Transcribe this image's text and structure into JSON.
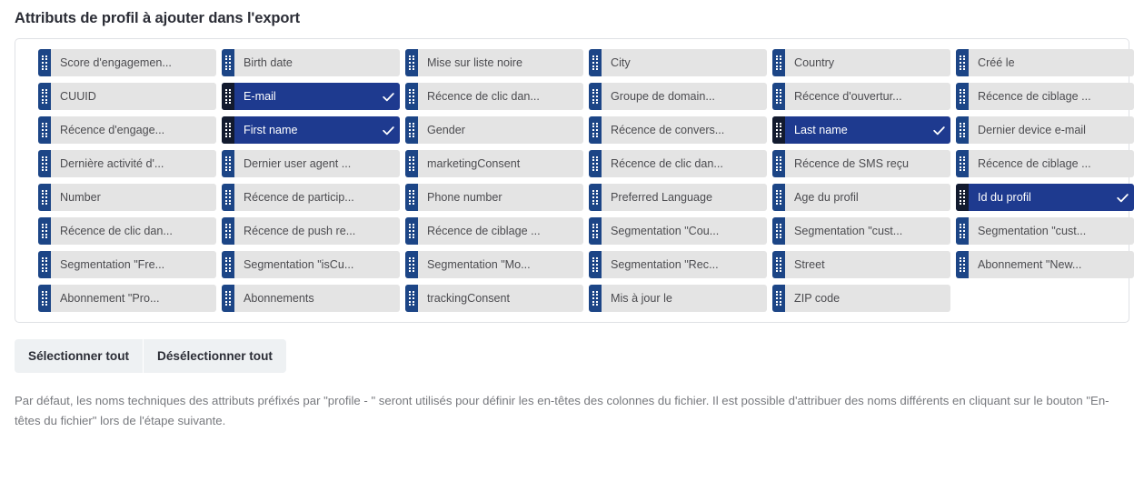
{
  "page_title": "Attributs de profil à ajouter dans l'export",
  "colors": {
    "chip_bg": "#e4e4e4",
    "chip_selected_bg": "#1e3a8f",
    "handle": "#1c4586",
    "handle_selected": "#121a2e",
    "panel_border": "#dfe1e5",
    "button_bg": "#eef1f3",
    "note_text": "#77797e"
  },
  "attributes": [
    {
      "label": "Score d'engagemen...",
      "selected": false
    },
    {
      "label": "Birth date",
      "selected": false
    },
    {
      "label": "Mise sur liste noire",
      "selected": false
    },
    {
      "label": "City",
      "selected": false
    },
    {
      "label": "Country",
      "selected": false
    },
    {
      "label": "Créé le",
      "selected": false
    },
    {
      "label": "CUUID",
      "selected": false
    },
    {
      "label": "E-mail",
      "selected": true
    },
    {
      "label": "Récence de clic dan...",
      "selected": false
    },
    {
      "label": "Groupe de domain...",
      "selected": false
    },
    {
      "label": "Récence d'ouvertur...",
      "selected": false
    },
    {
      "label": "Récence de ciblage ...",
      "selected": false
    },
    {
      "label": "Récence d'engage...",
      "selected": false
    },
    {
      "label": "First name",
      "selected": true
    },
    {
      "label": "Gender",
      "selected": false
    },
    {
      "label": "Récence de convers...",
      "selected": false
    },
    {
      "label": "Last name",
      "selected": true
    },
    {
      "label": "Dernier device e-mail",
      "selected": false
    },
    {
      "label": "Dernière activité d'...",
      "selected": false
    },
    {
      "label": "Dernier user agent ...",
      "selected": false
    },
    {
      "label": "marketingConsent",
      "selected": false
    },
    {
      "label": "Récence de clic dan...",
      "selected": false
    },
    {
      "label": "Récence de SMS reçu",
      "selected": false
    },
    {
      "label": "Récence de ciblage ...",
      "selected": false
    },
    {
      "label": "Number",
      "selected": false
    },
    {
      "label": "Récence de particip...",
      "selected": false
    },
    {
      "label": "Phone number",
      "selected": false
    },
    {
      "label": "Preferred Language",
      "selected": false
    },
    {
      "label": "Age du profil",
      "selected": false
    },
    {
      "label": "Id du profil",
      "selected": true
    },
    {
      "label": "Récence de clic dan...",
      "selected": false
    },
    {
      "label": "Récence de push re...",
      "selected": false
    },
    {
      "label": "Récence de ciblage ...",
      "selected": false
    },
    {
      "label": "Segmentation \"Cou...",
      "selected": false
    },
    {
      "label": "Segmentation \"cust...",
      "selected": false
    },
    {
      "label": "Segmentation \"cust...",
      "selected": false
    },
    {
      "label": "Segmentation \"Fre...",
      "selected": false
    },
    {
      "label": "Segmentation \"isCu...",
      "selected": false
    },
    {
      "label": "Segmentation \"Mo...",
      "selected": false
    },
    {
      "label": "Segmentation \"Rec...",
      "selected": false
    },
    {
      "label": "Street",
      "selected": false
    },
    {
      "label": "Abonnement \"New...",
      "selected": false
    },
    {
      "label": "Abonnement \"Pro...",
      "selected": false
    },
    {
      "label": "Abonnements",
      "selected": false
    },
    {
      "label": "trackingConsent",
      "selected": false
    },
    {
      "label": "Mis à jour le",
      "selected": false
    },
    {
      "label": "ZIP code",
      "selected": false
    }
  ],
  "buttons": {
    "select_all": "Sélectionner tout",
    "deselect_all": "Désélectionner tout"
  },
  "note": "Par défaut, les noms techniques des attributs préfixés par \"profile - \" seront utilisés pour définir les en-têtes des colonnes du fichier. Il est possible d'attribuer des noms différents en cliquant sur le bouton \"En-têtes du fichier\" lors de l'étape suivante."
}
